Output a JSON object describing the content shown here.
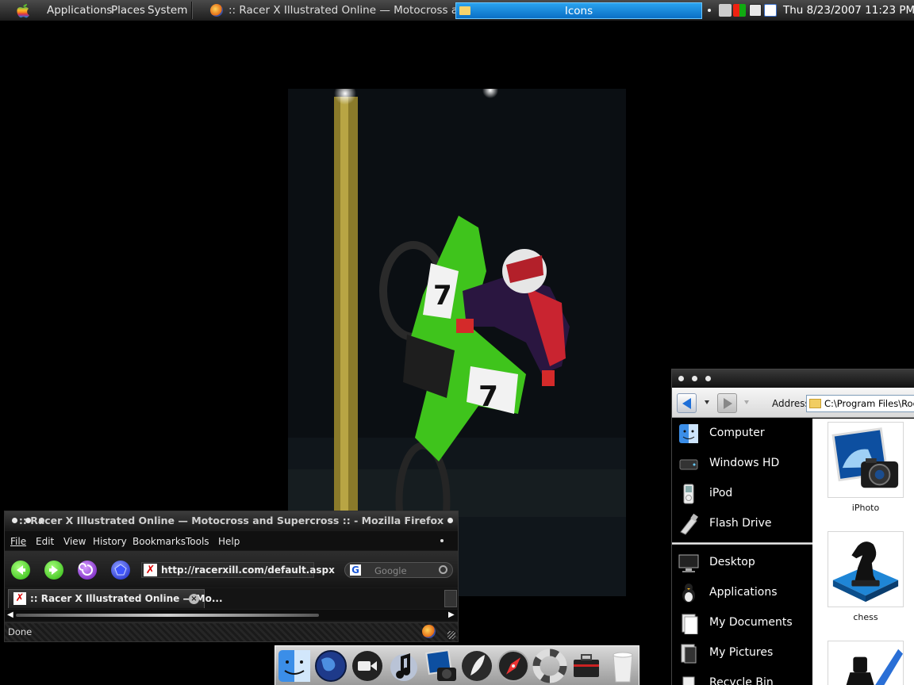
{
  "top_panel": {
    "menus": {
      "applications": "Applications",
      "places": "Places",
      "system": "System"
    },
    "tasks": {
      "firefox": ":: Racer X Illustrated Online — Motocross an...",
      "icons": "Icons"
    },
    "clock": "Thu 8/23/2007 11:23 PM"
  },
  "firefox": {
    "title": ":: Racer X Illustrated Online — Motocross and Supercross :: - Mozilla Firefox",
    "menu": {
      "file": "File",
      "edit": "Edit",
      "view": "View",
      "history": "History",
      "bookmarks": "Bookmarks",
      "tools": "Tools",
      "help": "Help"
    },
    "url": "http://racerxill.com/default.aspx",
    "search_placeholder": "Google",
    "tab_title": ":: Racer X Illustrated Online — Mo...",
    "status": "Done"
  },
  "explorer": {
    "address_label": "Address",
    "address": "C:\\Program Files\\Rocket",
    "sidebar": [
      {
        "label": "Computer",
        "icon": "finder-face-icon"
      },
      {
        "label": "Windows HD",
        "icon": "hard-drive-icon"
      },
      {
        "label": "iPod",
        "icon": "ipod-icon"
      },
      {
        "label": "Flash Drive",
        "icon": "flash-drive-icon"
      },
      {
        "label": "Desktop",
        "icon": "monitor-icon"
      },
      {
        "label": "Applications",
        "icon": "applications-icon"
      },
      {
        "label": "My Documents",
        "icon": "documents-icon"
      },
      {
        "label": "My Pictures",
        "icon": "pictures-icon"
      },
      {
        "label": "Recycle Bin",
        "icon": "recycle-bin-icon"
      }
    ],
    "tiles": [
      {
        "label": "iPhoto",
        "icon": "iphoto-icon"
      },
      {
        "label": "chess",
        "icon": "chess-knight-icon"
      },
      {
        "label": "",
        "icon": "ink-pen-icon"
      }
    ]
  },
  "dock": [
    {
      "icon": "finder-icon"
    },
    {
      "icon": "globe-icon"
    },
    {
      "icon": "video-camera-icon"
    },
    {
      "icon": "itunes-icon"
    },
    {
      "icon": "iphoto-icon"
    },
    {
      "icon": "feather-icon"
    },
    {
      "icon": "safari-compass-icon"
    },
    {
      "icon": "lifebuoy-icon"
    },
    {
      "icon": "toolbox-icon"
    },
    {
      "icon": "trash-icon"
    }
  ],
  "colors": {
    "task_active": "#0a6fc6",
    "ff_green": "#3fd21c",
    "ff_purple": "#8a2fd6",
    "ff_blue": "#2a3cf0"
  }
}
